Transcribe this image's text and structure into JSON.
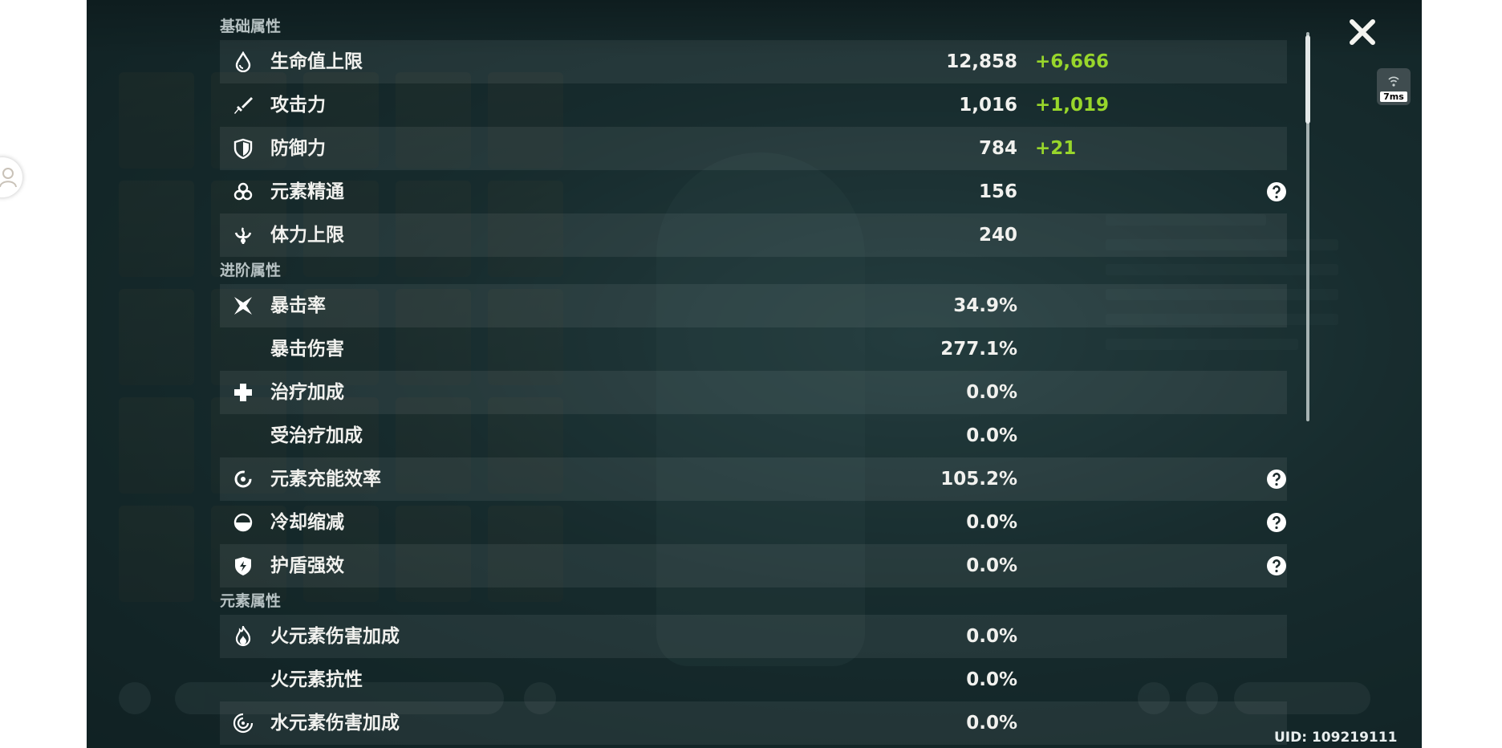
{
  "ping": "7ms",
  "uid": "UID: 109219111",
  "sections": {
    "basic": "基础属性",
    "advanced": "进阶属性",
    "element": "元素属性"
  },
  "stats": {
    "hp": {
      "label": "生命值上限",
      "value": "12,858",
      "bonus": "+6,666"
    },
    "atk": {
      "label": "攻击力",
      "value": "1,016",
      "bonus": "+1,019"
    },
    "def": {
      "label": "防御力",
      "value": "784",
      "bonus": "+21"
    },
    "em": {
      "label": "元素精通",
      "value": "156"
    },
    "stamina": {
      "label": "体力上限",
      "value": "240"
    },
    "crit_rate": {
      "label": "暴击率",
      "value": "34.9%"
    },
    "crit_dmg": {
      "label": "暴击伤害",
      "value": "277.1%"
    },
    "heal": {
      "label": "治疗加成",
      "value": "0.0%"
    },
    "incoming_heal": {
      "label": "受治疗加成",
      "value": "0.0%"
    },
    "er": {
      "label": "元素充能效率",
      "value": "105.2%"
    },
    "cd": {
      "label": "冷却缩减",
      "value": "0.0%"
    },
    "shield": {
      "label": "护盾强效",
      "value": "0.0%"
    },
    "pyro_dmg": {
      "label": "火元素伤害加成",
      "value": "0.0%"
    },
    "pyro_res": {
      "label": "火元素抗性",
      "value": "0.0%"
    },
    "hydro_dmg": {
      "label": "水元素伤害加成",
      "value": "0.0%"
    }
  },
  "colors": {
    "bonus": "#98d62b",
    "text": "#f1f1ee",
    "section": "#b7c2c3"
  }
}
